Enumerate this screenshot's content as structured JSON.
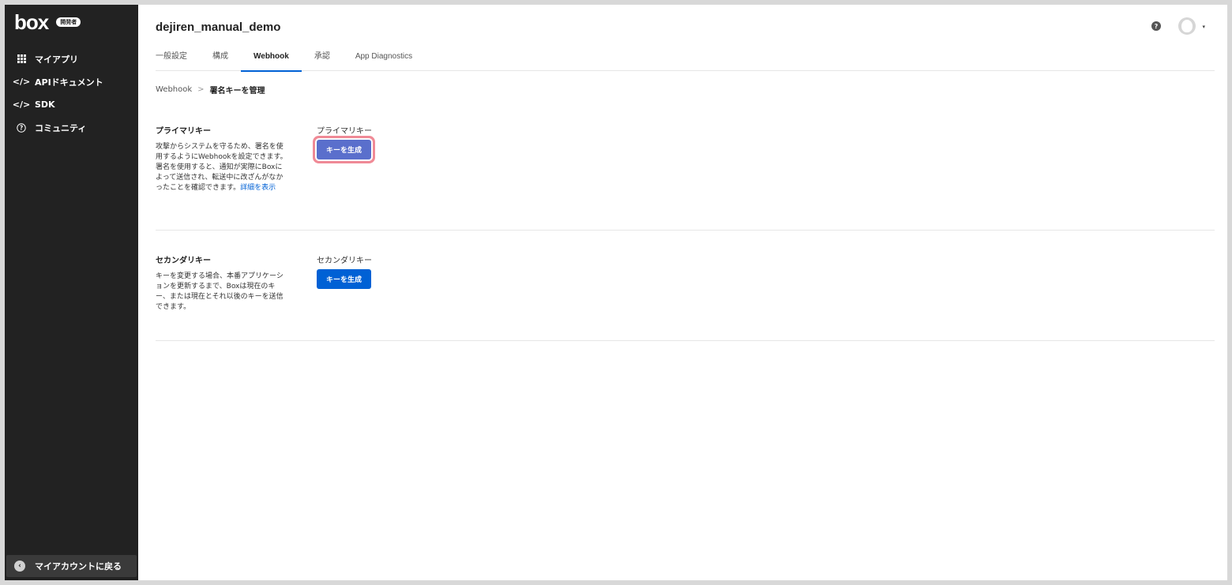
{
  "sidebar": {
    "logo": "box",
    "badge": "開発者",
    "items": [
      {
        "label": "マイアプリ",
        "icon": "grid-icon"
      },
      {
        "label": "APIドキュメント",
        "icon": "code-icon"
      },
      {
        "label": "SDK",
        "icon": "code-icon"
      },
      {
        "label": "コミュニティ",
        "icon": "help-circle-icon"
      }
    ],
    "back_label": "マイアカウントに戻る"
  },
  "header": {
    "title": "dejiren_manual_demo",
    "help_icon": "?",
    "avatar_caret": "▾"
  },
  "tabs": [
    {
      "label": "一般設定",
      "active": false
    },
    {
      "label": "構成",
      "active": false
    },
    {
      "label": "Webhook",
      "active": true
    },
    {
      "label": "承認",
      "active": false
    },
    {
      "label": "App Diagnostics",
      "active": false
    }
  ],
  "breadcrumb": {
    "parent": "Webhook",
    "separator": ">",
    "current": "署名キーを管理"
  },
  "primary": {
    "title": "プライマリキー",
    "description": "攻撃からシステムを守るため、署名を使用するようにWebhookを設定できます。署名を使用すると、通知が実際にBoxによって送信され、転送中に改ざんがなかったことを確認できます。",
    "link": "詳細を表示",
    "action_label": "プライマリキー",
    "button": "キーを生成"
  },
  "secondary": {
    "title": "セカンダリキー",
    "description": "キーを変更する場合、本番アプリケーションを更新するまで、Boxは現在のキー、または現在とそれ以後のキーを送信できます。",
    "action_label": "セカンダリキー",
    "button": "キーを生成"
  },
  "colors": {
    "sidebar_bg": "#222222",
    "accent": "#0061d5",
    "highlight_ring": "#f08a96"
  }
}
